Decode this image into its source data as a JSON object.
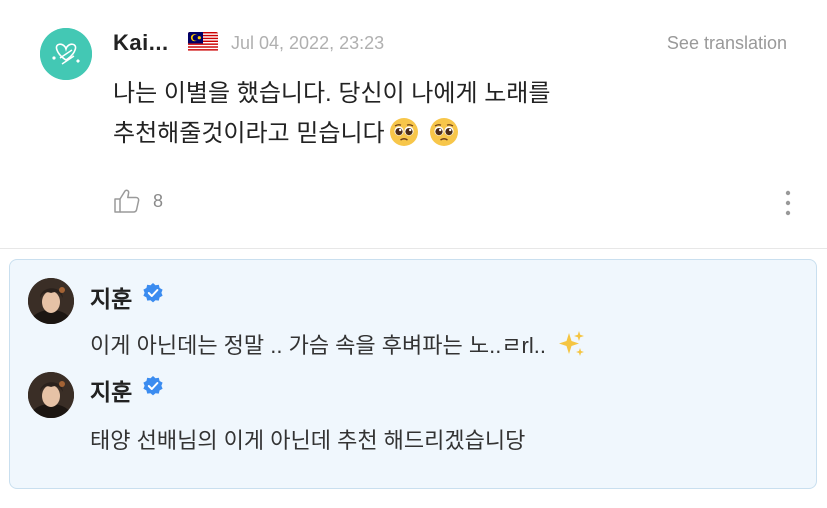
{
  "post": {
    "author": "Kai...",
    "flag_icon": "malaysia-flag-icon",
    "date": "Jul 04, 2022, 23:23",
    "see_translation": "See translation",
    "text": "나는 이별을 했습니다. 당신이 나에게 노래를\n추천해줄것이라고 믿습니다",
    "emoji_icons": [
      "pleading-face-icon",
      "pleading-face-icon"
    ],
    "likes": "8"
  },
  "replies": [
    {
      "name": "지훈",
      "verified_icon": "verified-badge-icon",
      "text": "이게 아닌데는 정말 .. 가슴 속을 후벼파는 노..ㄹrl..",
      "emoji_icon": "sparkles-icon"
    },
    {
      "name": "지훈",
      "verified_icon": "verified-badge-icon",
      "text": "태양 선배님의 이게 아닌데 추천 해드리겠습니당"
    }
  ],
  "colors": {
    "avatar_teal": "#43c8b4",
    "verified_blue": "#3b8cf0",
    "reply_bg": "#f0f7fd",
    "reply_border": "#c9dfef"
  }
}
